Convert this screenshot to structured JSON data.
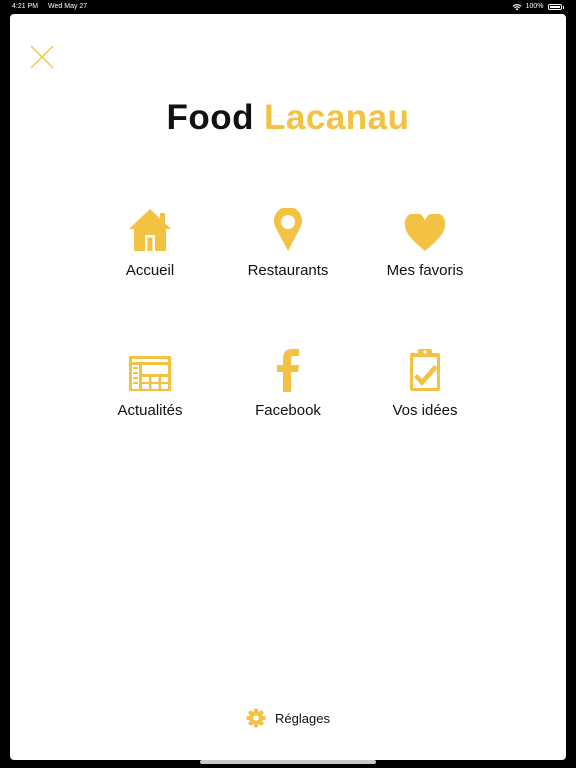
{
  "status_bar": {
    "time": "4:21 PM",
    "date": "Wed May 27",
    "battery": "100%"
  },
  "logo": {
    "word1": "Food",
    "word2": "Lacanau"
  },
  "menu": {
    "items": [
      {
        "label": "Accueil",
        "icon": "home-icon"
      },
      {
        "label": "Restaurants",
        "icon": "map-pin-icon"
      },
      {
        "label": "Mes favoris",
        "icon": "heart-icon"
      },
      {
        "label": "Actualités",
        "icon": "newspaper-icon"
      },
      {
        "label": "Facebook",
        "icon": "facebook-icon"
      },
      {
        "label": "Vos idées",
        "icon": "clipboard-check-icon"
      }
    ]
  },
  "settings": {
    "label": "Réglages",
    "icon": "gear-icon"
  },
  "colors": {
    "accent": "#f3c242",
    "text": "#111111",
    "background": "#ffffff"
  }
}
